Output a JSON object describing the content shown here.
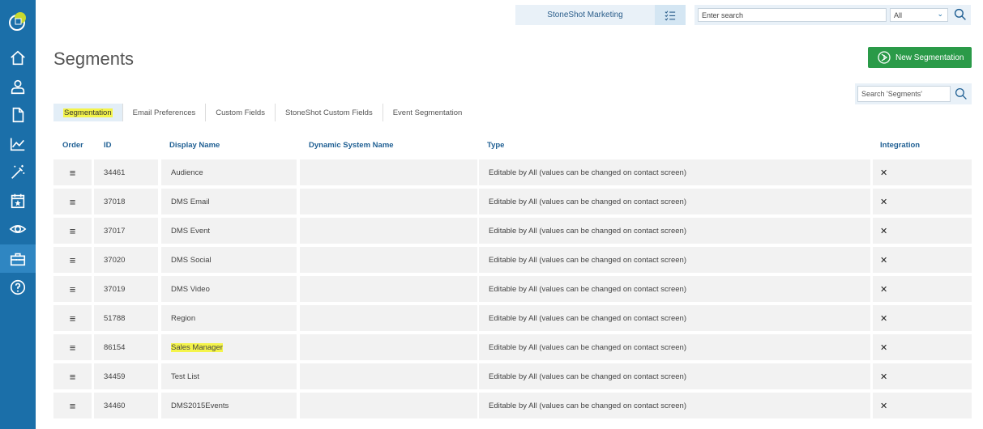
{
  "header": {
    "account_name": "StoneShot Marketing",
    "search_placeholder": "Enter search",
    "search_scope": "All"
  },
  "page": {
    "title": "Segments",
    "new_button_label": "New Segmentation",
    "segments_search_placeholder": "Search 'Segments'"
  },
  "sidebar": {
    "items": [
      {
        "icon": "home-icon"
      },
      {
        "icon": "user-icon"
      },
      {
        "icon": "document-icon"
      },
      {
        "icon": "chart-icon"
      },
      {
        "icon": "magic-wand-icon"
      },
      {
        "icon": "calendar-star-icon"
      },
      {
        "icon": "eye-icon"
      },
      {
        "icon": "toolbox-icon",
        "active": true
      },
      {
        "icon": "help-icon"
      }
    ]
  },
  "tabs": [
    {
      "label": "Segmentation",
      "active": true
    },
    {
      "label": "Email Preferences"
    },
    {
      "label": "Custom Fields"
    },
    {
      "label": "StoneShot Custom Fields"
    },
    {
      "label": "Event Segmentation"
    }
  ],
  "table": {
    "columns": [
      "Order",
      "ID",
      "Display Name",
      "Dynamic System Name",
      "Type",
      "Integration"
    ],
    "rows": [
      {
        "id": "34461",
        "name": "Audience",
        "dynamic": "",
        "type": "Editable by All (values can be changed on contact screen)",
        "integration": "✕"
      },
      {
        "id": "37018",
        "name": "DMS Email",
        "dynamic": "",
        "type": "Editable by All (values can be changed on contact screen)",
        "integration": "✕"
      },
      {
        "id": "37017",
        "name": "DMS Event",
        "dynamic": "",
        "type": "Editable by All (values can be changed on contact screen)",
        "integration": "✕"
      },
      {
        "id": "37020",
        "name": "DMS Social",
        "dynamic": "",
        "type": "Editable by All (values can be changed on contact screen)",
        "integration": "✕"
      },
      {
        "id": "37019",
        "name": "DMS Video",
        "dynamic": "",
        "type": "Editable by All (values can be changed on contact screen)",
        "integration": "✕"
      },
      {
        "id": "51788",
        "name": "Region",
        "dynamic": "",
        "type": "Editable by All (values can be changed on contact screen)",
        "integration": "✕"
      },
      {
        "id": "86154",
        "name": "Sales Manager",
        "dynamic": "",
        "type": "Editable by All (values can be changed on contact screen)",
        "integration": "✕",
        "highlight": true
      },
      {
        "id": "34459",
        "name": "Test List",
        "dynamic": "",
        "type": "Editable by All (values can be changed on contact screen)",
        "integration": "✕"
      },
      {
        "id": "34460",
        "name": "DMS2015Events",
        "dynamic": "",
        "type": "Editable by All (values can be changed on contact screen)",
        "integration": "✕"
      }
    ]
  },
  "colors": {
    "sidebar": "#1b6fa9",
    "sidebar_active": "#2f86c2",
    "accent_blue": "#1f5f93",
    "new_button": "#2a9a48",
    "highlight": "#f4f44a"
  }
}
